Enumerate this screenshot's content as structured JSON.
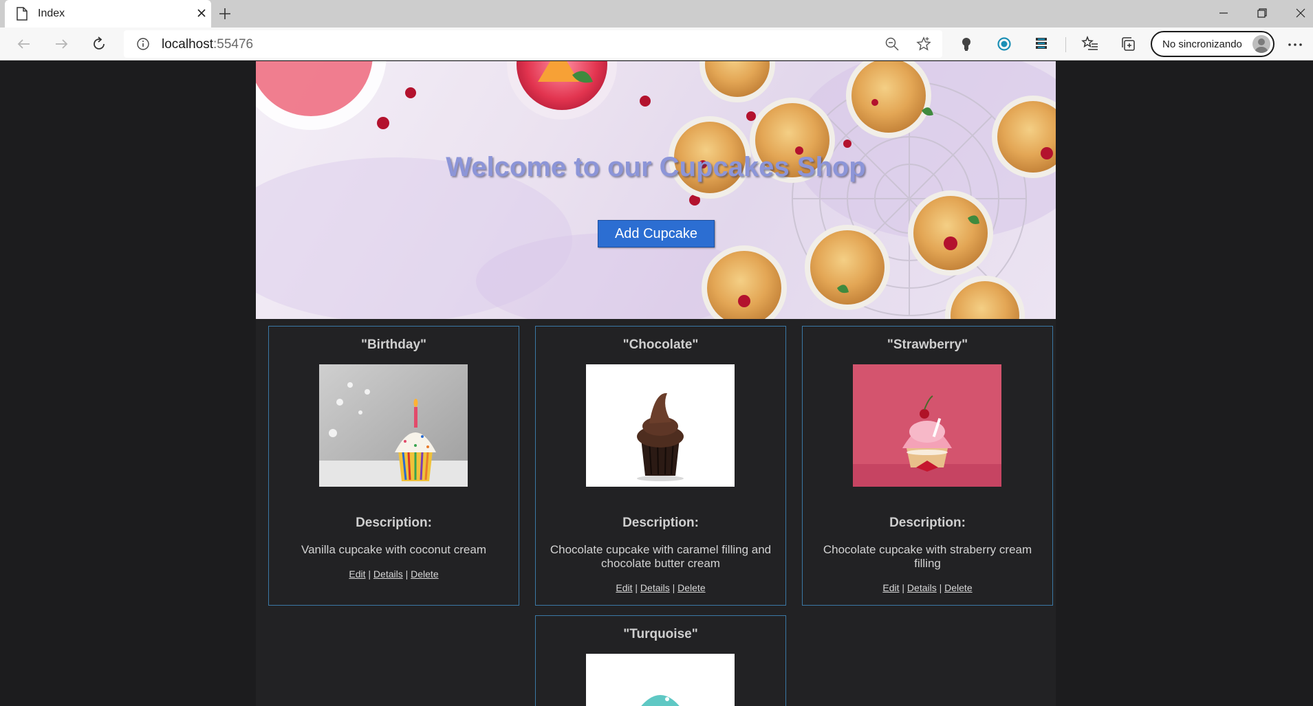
{
  "browser": {
    "tab_title": "Index",
    "url_host": "localhost",
    "url_port": ":55476",
    "profile_label": "No sincronizando"
  },
  "hero": {
    "title": "Welcome to our Cupcakes Shop",
    "add_button": "Add Cupcake"
  },
  "cards": [
    {
      "name": "\"Birthday\"",
      "description_heading": "Description:",
      "description": "Vanilla cupcake with coconut cream",
      "edit": "Edit",
      "details": "Details",
      "delete": "Delete",
      "separator": "|"
    },
    {
      "name": "\"Chocolate\"",
      "description_heading": "Description:",
      "description": "Chocolate cupcake with caramel filling and chocolate butter cream",
      "edit": "Edit",
      "details": "Details",
      "delete": "Delete",
      "separator": "|"
    },
    {
      "name": "\"Strawberry\"",
      "description_heading": "Description:",
      "description": "Chocolate cupcake with straberry cream filling",
      "edit": "Edit",
      "details": "Details",
      "delete": "Delete",
      "separator": "|"
    },
    {
      "name": "\"Turquoise\""
    }
  ],
  "icons": {
    "tab": "document-icon",
    "back": "back-arrow-icon",
    "forward": "forward-arrow-icon",
    "refresh": "refresh-icon",
    "info": "info-icon",
    "zoom": "zoom-out-icon",
    "favorite": "star-icon",
    "extensions": [
      "lightbulb-icon",
      "circle-extension-icon",
      "stack-extension-icon"
    ],
    "favorites": "favorites-icon",
    "collections": "collections-icon",
    "more": "more-icon"
  },
  "colors": {
    "page_bg": "#1c1c1e",
    "container_bg": "#222224",
    "card_border": "#3b79a6",
    "button_bg": "#2c6ed2",
    "hero_title": "#8c95d8"
  }
}
